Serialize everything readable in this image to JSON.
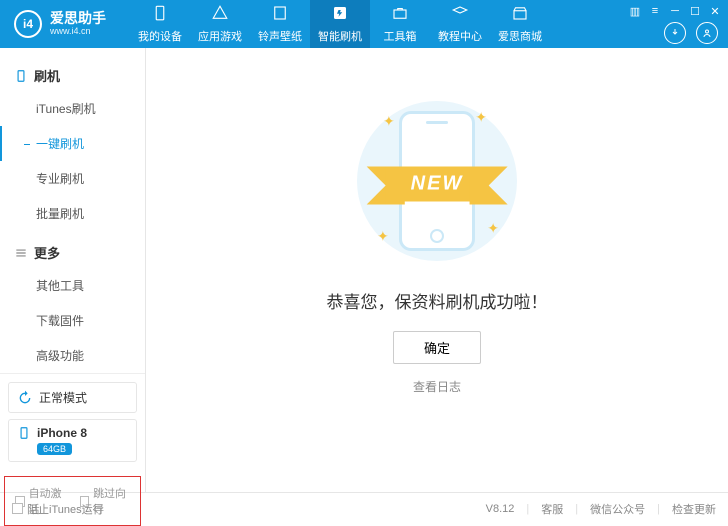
{
  "app": {
    "name": "爱思助手",
    "url": "www.i4.cn"
  },
  "tabs": [
    {
      "label": "我的设备",
      "icon": "device"
    },
    {
      "label": "应用游戏",
      "icon": "apps"
    },
    {
      "label": "铃声壁纸",
      "icon": "ringtone"
    },
    {
      "label": "智能刷机",
      "icon": "flash"
    },
    {
      "label": "工具箱",
      "icon": "toolbox"
    },
    {
      "label": "教程中心",
      "icon": "tutorial"
    },
    {
      "label": "爱思商城",
      "icon": "store"
    }
  ],
  "active_tab_index": 3,
  "sidebar": {
    "sections": [
      {
        "title": "刷机",
        "items": [
          "iTunes刷机",
          "一键刷机",
          "专业刷机",
          "批量刷机"
        ],
        "active_index": 1
      },
      {
        "title": "更多",
        "items": [
          "其他工具",
          "下载固件",
          "高级功能"
        ]
      }
    ],
    "mode": "正常模式",
    "device": {
      "name": "iPhone 8",
      "storage": "64GB"
    },
    "options": {
      "auto_activate": "自动激活",
      "skip_wizard": "跳过向导"
    }
  },
  "content": {
    "ribbon": "NEW",
    "title": "恭喜您，保资料刷机成功啦！",
    "ok": "确定",
    "log": "查看日志"
  },
  "statusbar": {
    "block_itunes": "阻止iTunes运行",
    "version": "V8.12",
    "links": [
      "客服",
      "微信公众号",
      "检查更新"
    ]
  }
}
